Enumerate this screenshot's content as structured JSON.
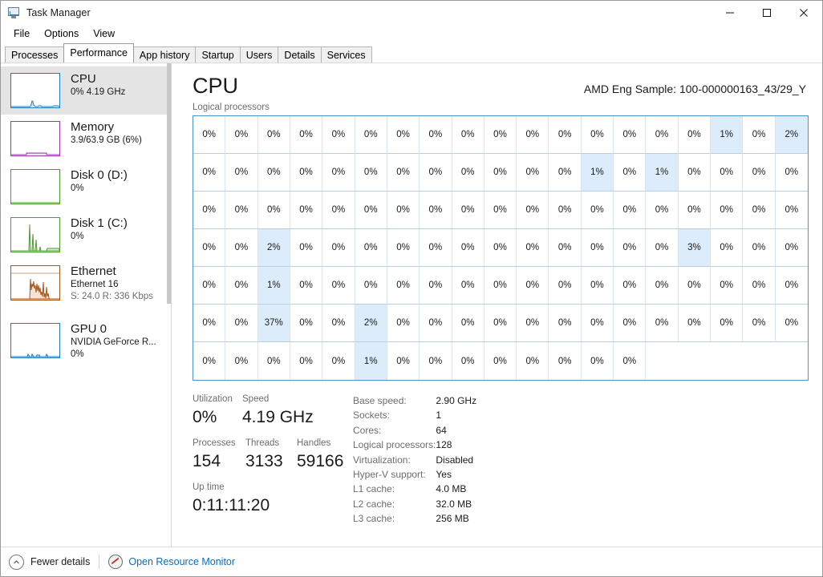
{
  "window": {
    "title": "Task Manager",
    "icon": "task-manager-icon",
    "minimize": "—",
    "maximize": "□",
    "close": "✕"
  },
  "menu": [
    "File",
    "Options",
    "View"
  ],
  "tabs": [
    {
      "label": "Processes",
      "active": false
    },
    {
      "label": "Performance",
      "active": true
    },
    {
      "label": "App history",
      "active": false
    },
    {
      "label": "Startup",
      "active": false
    },
    {
      "label": "Users",
      "active": false
    },
    {
      "label": "Details",
      "active": false
    },
    {
      "label": "Services",
      "active": false
    }
  ],
  "sidebar": {
    "items": [
      {
        "name": "cpu",
        "title": "CPU",
        "sub1": "0%  4.19 GHz",
        "sub2": "",
        "sub3": "",
        "color": "#1e7bb8",
        "selected": true
      },
      {
        "name": "memory",
        "title": "Memory",
        "sub1": "3.9/63.9 GB (6%)",
        "sub2": "",
        "sub3": "",
        "color": "#9b35b0",
        "selected": false
      },
      {
        "name": "disk-0",
        "title": "Disk 0 (D:)",
        "sub1": "0%",
        "sub2": "",
        "sub3": "",
        "color": "#4e9a2f",
        "selected": false
      },
      {
        "name": "disk-1",
        "title": "Disk 1 (C:)",
        "sub1": "0%",
        "sub2": "",
        "sub3": "",
        "color": "#4e9a2f",
        "selected": false
      },
      {
        "name": "ethernet",
        "title": "Ethernet",
        "sub1": "Ethernet 16",
        "sub2": "S: 24.0 R: 336 Kbps",
        "sub3": "",
        "color": "#a5561b",
        "selected": false
      },
      {
        "name": "gpu-0",
        "title": "GPU 0",
        "sub1": "NVIDIA GeForce R...",
        "sub2": "0%",
        "sub3": "",
        "color": "#1e7bb8",
        "selected": false
      }
    ]
  },
  "main": {
    "title": "CPU",
    "model": "AMD Eng Sample: 100-000000163_43/29_Y",
    "graph_label": "Logical processors"
  },
  "chart_data": {
    "type": "heatmap",
    "title": "Logical processors",
    "columns": 19,
    "rows": 7,
    "unit": "%",
    "total_cells": 128,
    "values": [
      [
        0,
        0,
        0,
        0,
        0,
        0,
        0,
        0,
        0,
        0,
        0,
        0,
        0,
        0,
        0,
        0,
        1,
        0,
        2
      ],
      [
        0,
        0,
        0,
        0,
        0,
        0,
        0,
        0,
        0,
        0,
        0,
        0,
        1,
        0,
        1,
        0,
        0,
        0,
        0
      ],
      [
        0,
        0,
        0,
        0,
        0,
        0,
        0,
        0,
        0,
        0,
        0,
        0,
        0,
        0,
        0,
        0,
        0,
        0,
        0
      ],
      [
        0,
        0,
        2,
        0,
        0,
        0,
        0,
        0,
        0,
        0,
        0,
        0,
        0,
        0,
        0,
        3,
        0,
        0,
        0
      ],
      [
        0,
        0,
        1,
        0,
        0,
        0,
        0,
        0,
        0,
        0,
        0,
        0,
        0,
        0,
        0,
        0,
        0,
        0,
        0
      ],
      [
        0,
        0,
        37,
        0,
        0,
        2,
        0,
        0,
        0,
        0,
        0,
        0,
        0,
        0,
        0,
        0,
        0,
        0,
        0
      ],
      [
        0,
        0,
        0,
        0,
        0,
        1,
        0,
        0,
        0,
        0,
        0,
        0,
        0,
        0
      ]
    ],
    "highlight_color": "#dcecfa",
    "border_color": "#4a93c8"
  },
  "stats": {
    "utilization_label": "Utilization",
    "utilization_value": "0%",
    "speed_label": "Speed",
    "speed_value": "4.19 GHz",
    "processes_label": "Processes",
    "processes_value": "154",
    "threads_label": "Threads",
    "threads_value": "3133",
    "handles_label": "Handles",
    "handles_value": "59166",
    "uptime_label": "Up time",
    "uptime_value": "0:11:11:20"
  },
  "specs": [
    {
      "key": "Base speed:",
      "value": "2.90 GHz"
    },
    {
      "key": "Sockets:",
      "value": "1"
    },
    {
      "key": "Cores:",
      "value": "64"
    },
    {
      "key": "Logical processors:",
      "value": "128"
    },
    {
      "key": "Virtualization:",
      "value": "Disabled"
    },
    {
      "key": "Hyper-V support:",
      "value": "Yes"
    },
    {
      "key": "L1 cache:",
      "value": "4.0 MB"
    },
    {
      "key": "L2 cache:",
      "value": "32.0 MB"
    },
    {
      "key": "L3 cache:",
      "value": "256 MB"
    }
  ],
  "statusbar": {
    "fewer_details": "Fewer details",
    "resource_monitor": "Open Resource Monitor"
  }
}
